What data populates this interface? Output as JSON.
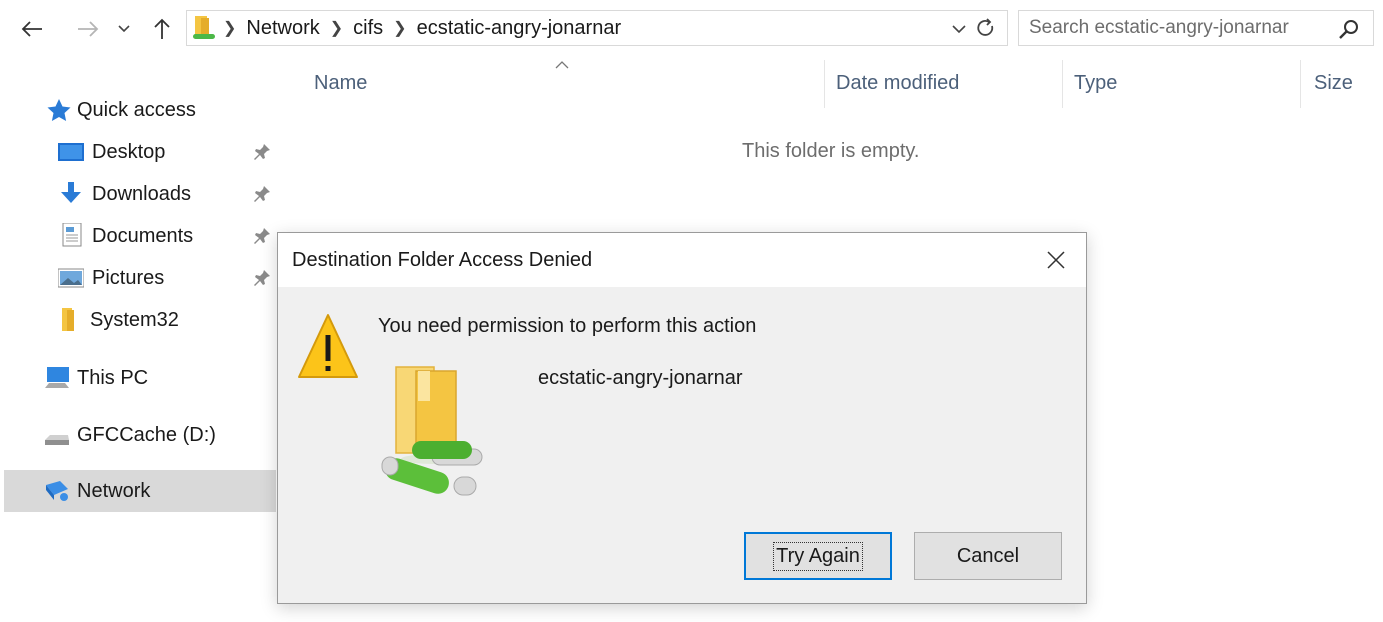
{
  "navbar": {
    "breadcrumbs": [
      "Network",
      "cifs",
      "ecstatic-angry-jonarnar"
    ],
    "search_placeholder": "Search ecstatic-angry-jonarnar"
  },
  "sidebar": {
    "quick_access": "Quick access",
    "items": [
      {
        "label": "Desktop",
        "icon": "desktop-icon",
        "pinned": true
      },
      {
        "label": "Downloads",
        "icon": "downloads-icon",
        "pinned": true
      },
      {
        "label": "Documents",
        "icon": "documents-icon",
        "pinned": true
      },
      {
        "label": "Pictures",
        "icon": "pictures-icon",
        "pinned": true
      },
      {
        "label": "System32",
        "icon": "folder-icon",
        "pinned": false
      }
    ],
    "this_pc": "This PC",
    "drive": "GFCCache (D:)",
    "network": "Network"
  },
  "file_list": {
    "columns": [
      "Name",
      "Date modified",
      "Type",
      "Size"
    ],
    "empty_message": "This folder is empty."
  },
  "dialog": {
    "title": "Destination Folder Access Denied",
    "message": "You need permission to perform this action",
    "folder_name": "ecstatic-angry-jonarnar",
    "try_again_label": "Try Again",
    "cancel_label": "Cancel"
  },
  "colors": {
    "accent": "#0078d7",
    "selected_bg": "#d9d9d9",
    "dialog_bg": "#f0f0f0",
    "column_header": "#4c607a",
    "warning": "#fcc419"
  }
}
